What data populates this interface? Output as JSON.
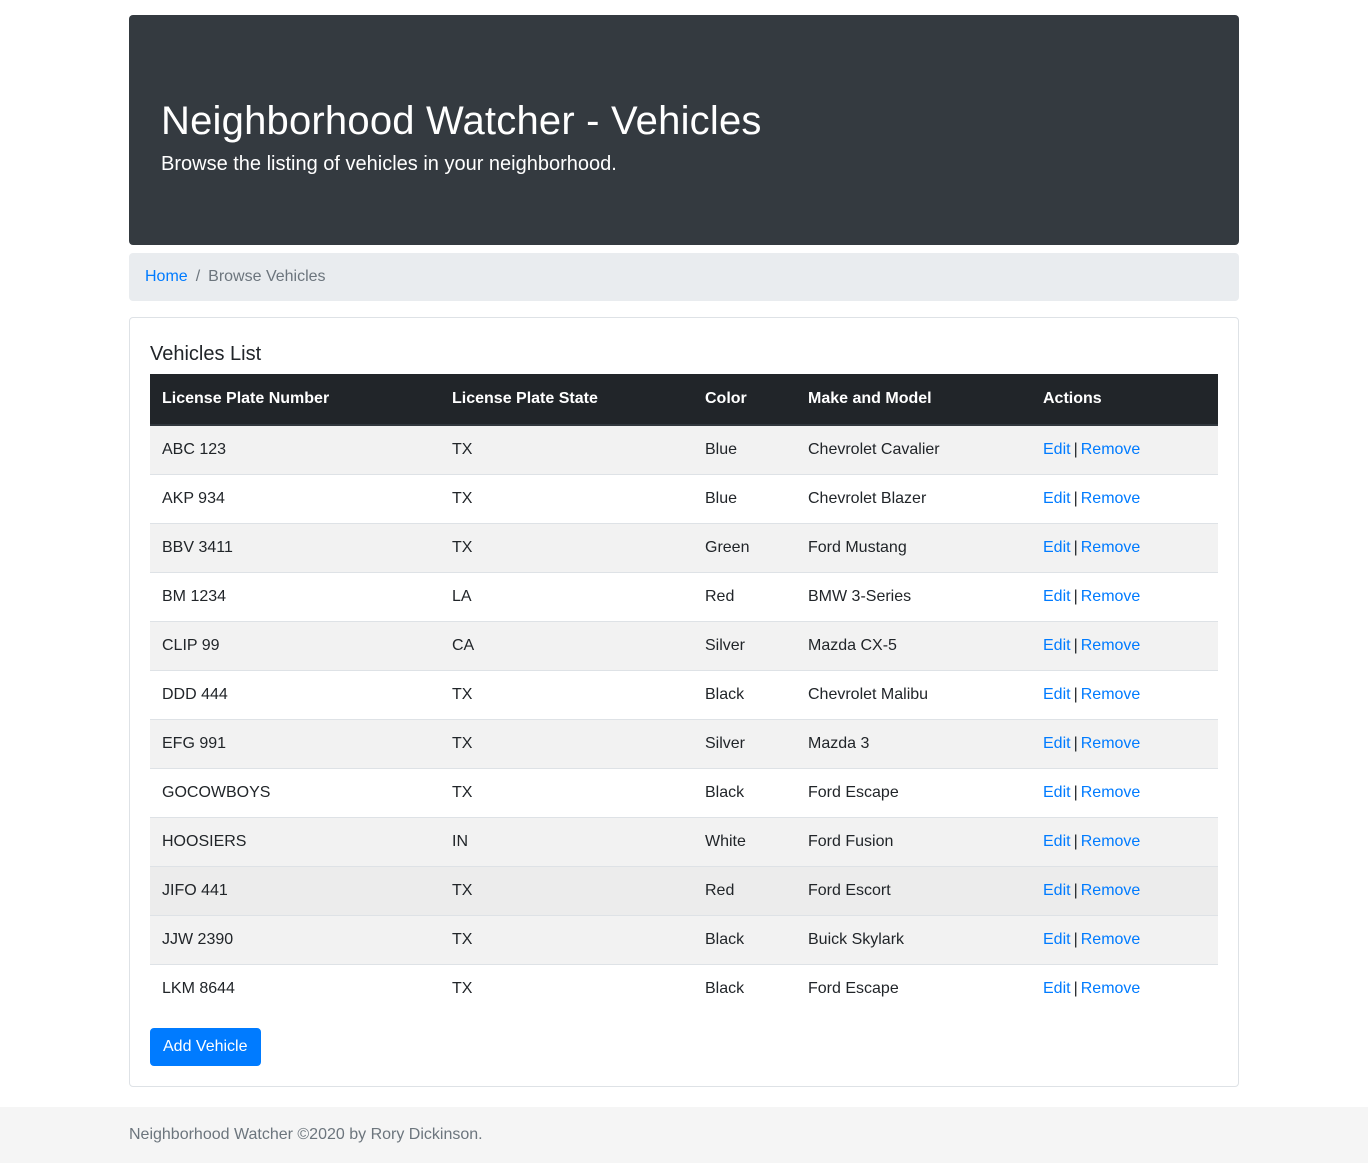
{
  "header": {
    "title": "Neighborhood Watcher - Vehicles",
    "subtitle": "Browse the listing of vehicles in your neighborhood."
  },
  "breadcrumb": {
    "home": "Home",
    "separator": "/",
    "current": "Browse Vehicles"
  },
  "card": {
    "title": "Vehicles List",
    "columns": [
      "License Plate Number",
      "License Plate State",
      "Color",
      "Make and Model",
      "Actions"
    ],
    "rows": [
      {
        "plate": "ABC 123",
        "state": "TX",
        "color": "Blue",
        "make_model": "Chevrolet Cavalier"
      },
      {
        "plate": "AKP 934",
        "state": "TX",
        "color": "Blue",
        "make_model": "Chevrolet Blazer"
      },
      {
        "plate": "BBV 3411",
        "state": "TX",
        "color": "Green",
        "make_model": "Ford Mustang"
      },
      {
        "plate": "BM 1234",
        "state": "LA",
        "color": "Red",
        "make_model": "BMW 3-Series"
      },
      {
        "plate": "CLIP 99",
        "state": "CA",
        "color": "Silver",
        "make_model": "Mazda CX-5"
      },
      {
        "plate": "DDD 444",
        "state": "TX",
        "color": "Black",
        "make_model": "Chevrolet Malibu"
      },
      {
        "plate": "EFG 991",
        "state": "TX",
        "color": "Silver",
        "make_model": "Mazda 3"
      },
      {
        "plate": "GOCOWBOYS",
        "state": "TX",
        "color": "Black",
        "make_model": "Ford Escape"
      },
      {
        "plate": "HOOSIERS",
        "state": "IN",
        "color": "White",
        "make_model": "Ford Fusion"
      },
      {
        "plate": "JIFO 441",
        "state": "TX",
        "color": "Red",
        "make_model": "Ford Escort"
      },
      {
        "plate": "JJW 2390",
        "state": "TX",
        "color": "Black",
        "make_model": "Buick Skylark"
      },
      {
        "plate": "LKM 8644",
        "state": "TX",
        "color": "Black",
        "make_model": "Ford Escape"
      }
    ],
    "actions": {
      "edit": "Edit",
      "separator": "|",
      "remove": "Remove"
    },
    "add_button": "Add Vehicle"
  },
  "footer": {
    "text": "Neighborhood Watcher ©2020 by Rory Dickinson."
  },
  "colors": {
    "header_bg": "#343a40",
    "link": "#007bff",
    "table_head_bg": "#212529",
    "breadcrumb_bg": "#e9ecef"
  }
}
